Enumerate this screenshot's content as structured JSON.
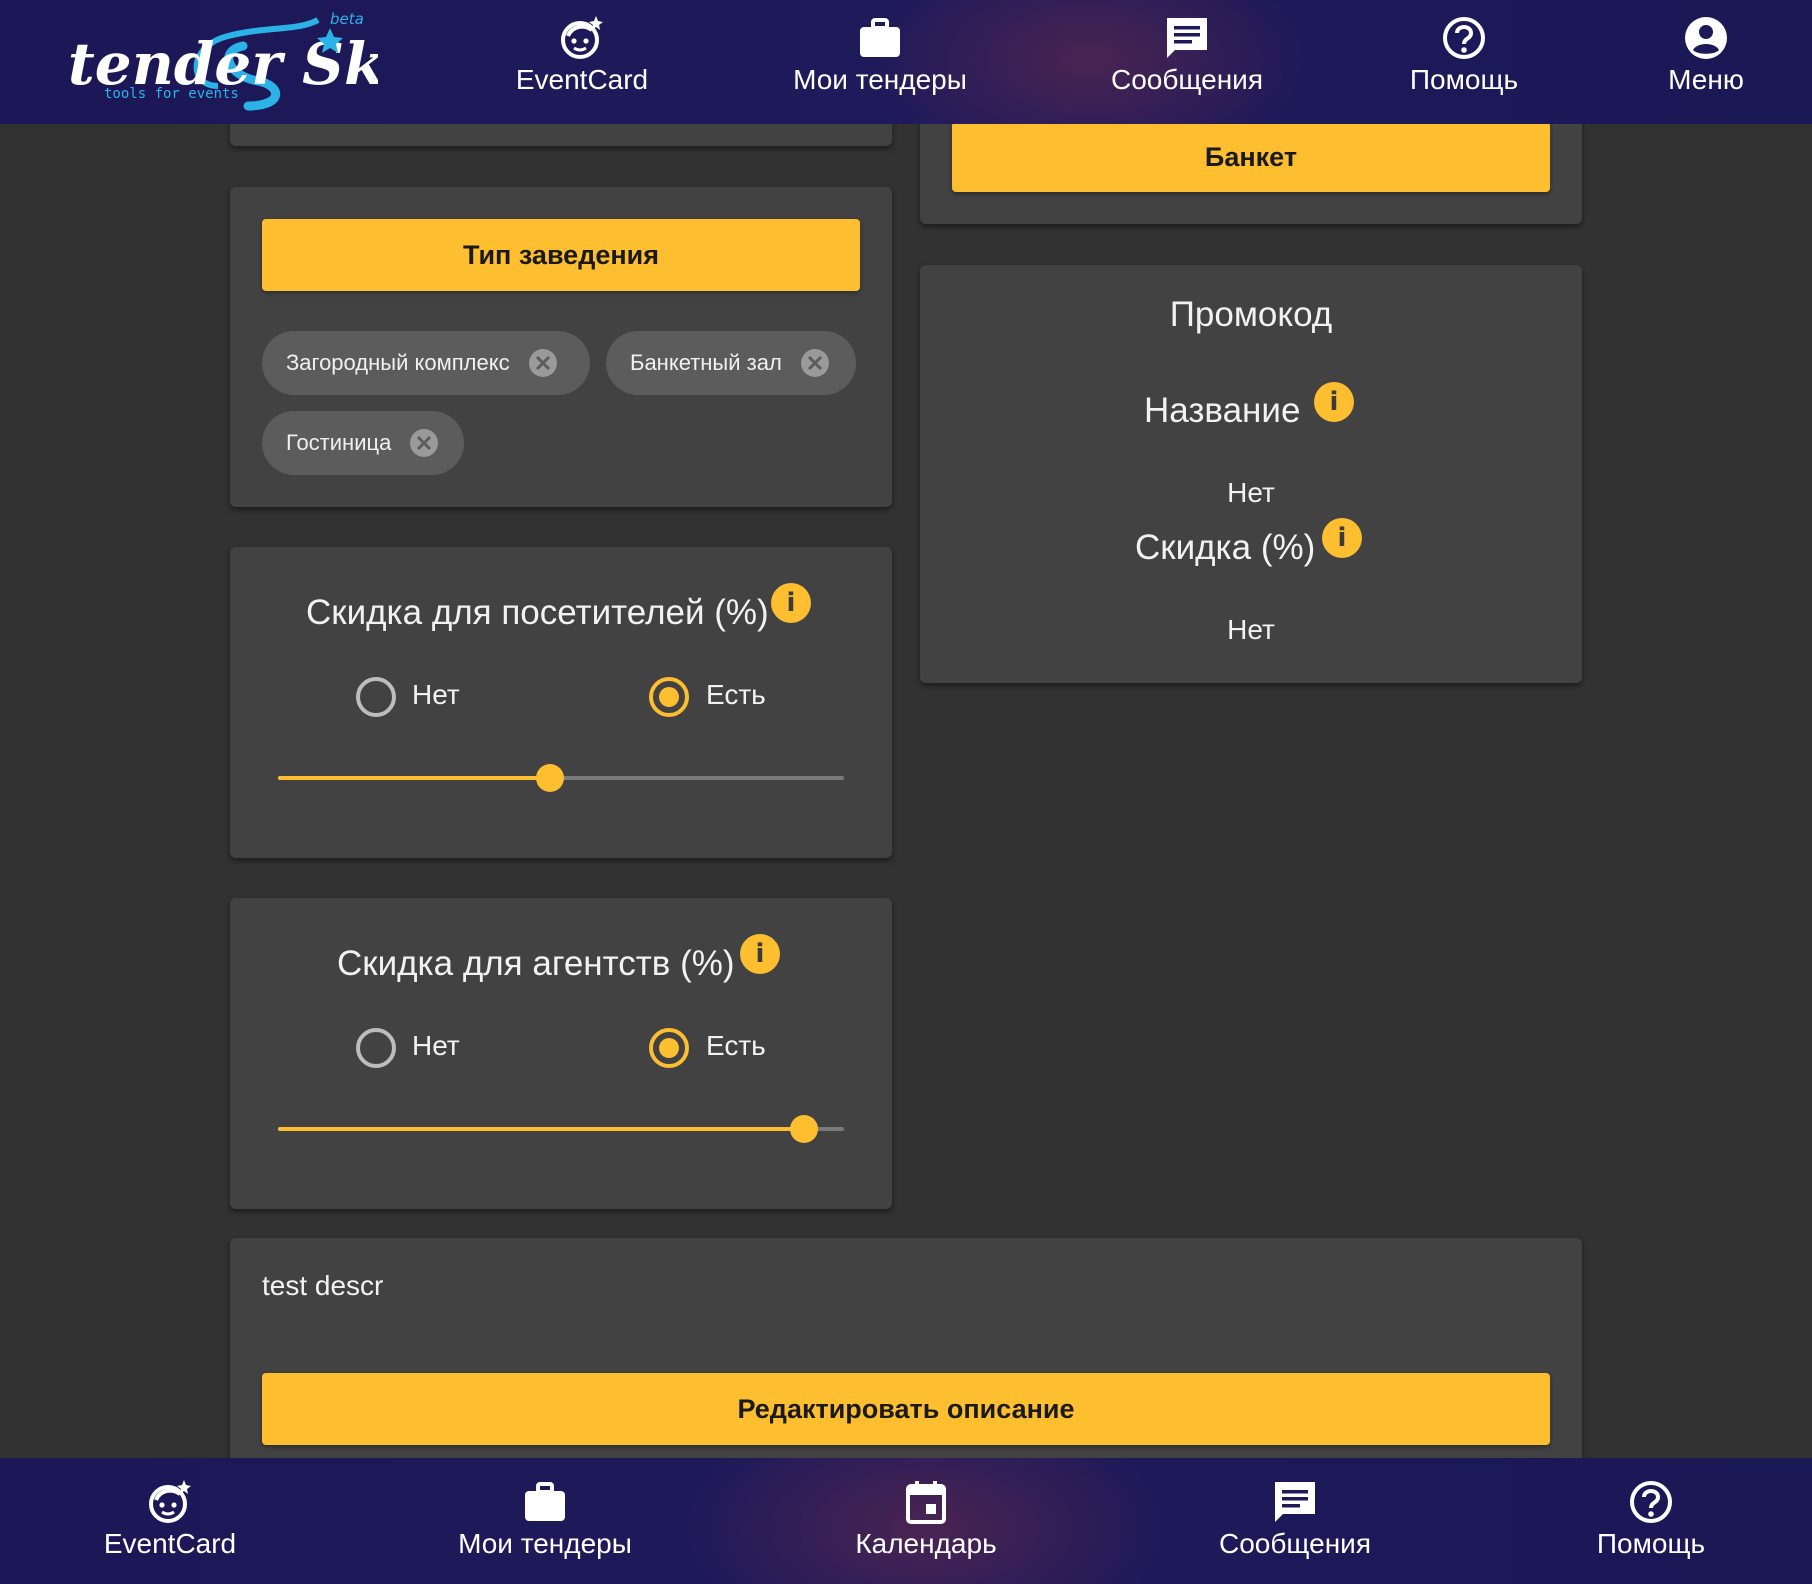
{
  "header": {
    "logo_text": "tender Sky",
    "logo_tagline": "tools for events",
    "logo_badge": "beta",
    "nav": [
      {
        "label": "EventCard",
        "icon": "eventcard-icon"
      },
      {
        "label": "Мои тендеры",
        "icon": "briefcase-icon"
      },
      {
        "label": "Сообщения",
        "icon": "message-icon"
      },
      {
        "label": "Помощь",
        "icon": "help-icon"
      },
      {
        "label": "Меню",
        "icon": "account-icon"
      }
    ]
  },
  "banquet": {
    "button_label": "Банкет"
  },
  "venue_type": {
    "button_label": "Тип заведения",
    "chips": [
      "Загородный комплекс",
      "Банкетный зал",
      "Гостиница"
    ]
  },
  "visitor_discount": {
    "title": "Скидка для посетителей (%)",
    "option_no": "Нет",
    "option_yes": "Есть",
    "selected": "Есть",
    "slider_fraction": 0.48
  },
  "agency_discount": {
    "title": "Скидка для агентств (%)",
    "option_no": "Нет",
    "option_yes": "Есть",
    "selected": "Есть",
    "slider_fraction": 0.93
  },
  "promo": {
    "title": "Промокод",
    "name_label": "Название",
    "name_value": "Нет",
    "discount_label": "Скидка (%)",
    "discount_value": "Нет"
  },
  "description": {
    "text": "test descr",
    "edit_button_label": "Редактировать описание"
  },
  "bottom_nav": [
    {
      "label": "EventCard",
      "icon": "eventcard-icon"
    },
    {
      "label": "Мои тендеры",
      "icon": "briefcase-icon"
    },
    {
      "label": "Календарь",
      "icon": "calendar-icon"
    },
    {
      "label": "Сообщения",
      "icon": "message-icon"
    },
    {
      "label": "Помощь",
      "icon": "help-icon"
    }
  ],
  "colors": {
    "accent": "#fdbe30",
    "nav_bg": "#1e1a5a",
    "card_bg": "#424242",
    "page_bg": "#323232"
  }
}
